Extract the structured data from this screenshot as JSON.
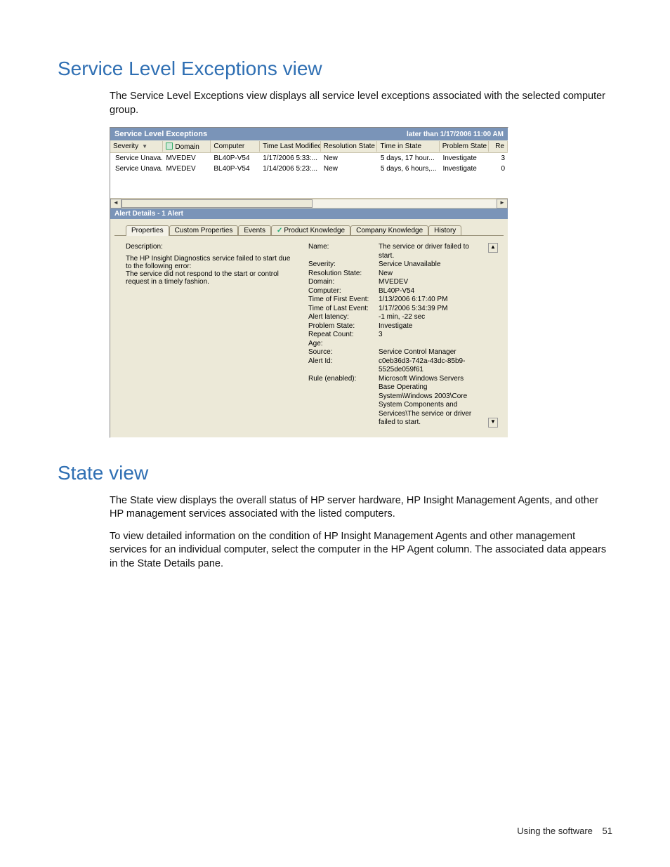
{
  "sections": {
    "sle": {
      "heading": "Service Level Exceptions view",
      "para": "The Service Level Exceptions view displays all service level exceptions associated with the selected computer group."
    },
    "state": {
      "heading": "State view",
      "para1": "The State view displays the overall status of HP server hardware, HP Insight Management Agents, and other HP management services associated with the listed computers.",
      "para2": "To view detailed information on the condition of HP Insight Management Agents and other management services for an individual computer, select the computer in the HP Agent column. The associated data appears in the State Details pane."
    }
  },
  "screenshot": {
    "title": "Service Level Exceptions",
    "stamp": "later than 1/17/2006 11:00 AM",
    "columns": {
      "severity": "Severity",
      "domain": "Domain",
      "computer": "Computer",
      "time_last_modified": "Time Last Modified",
      "resolution_state": "Resolution State",
      "time_in_state": "Time in State",
      "problem_state": "Problem State",
      "re": "Re"
    },
    "rows": [
      {
        "severity": "Service Unava...",
        "domain": "MVEDEV",
        "computer": "BL40P-V54",
        "time": "1/17/2006 5:33:...",
        "res": "New",
        "tis": "5 days, 17 hour...",
        "ps": "Investigate",
        "re": "3"
      },
      {
        "severity": "Service Unava...",
        "domain": "MVEDEV",
        "computer": "BL40P-V54",
        "time": "1/14/2006 5:23:...",
        "res": "New",
        "tis": "5 days, 6 hours,...",
        "ps": "Investigate",
        "re": "0"
      }
    ],
    "details_header": "Alert Details - 1 Alert",
    "tabs": {
      "properties": "Properties",
      "custom_properties": "Custom Properties",
      "events": "Events",
      "product_knowledge": "Product Knowledge",
      "company_knowledge": "Company Knowledge",
      "history": "History"
    },
    "description": {
      "label": "Description:",
      "line1": "The HP Insight Diagnostics service failed to start due to the following error:",
      "line2": "The service did not respond to the start or control request in a timely fashion."
    },
    "kv": {
      "name_k": "Name:",
      "name_v": "The service or driver failed to start.",
      "severity_k": "Severity:",
      "severity_v": "Service Unavailable",
      "res_k": "Resolution State:",
      "res_v": "New",
      "domain_k": "Domain:",
      "domain_v": "MVEDEV",
      "computer_k": "Computer:",
      "computer_v": "BL40P-V54",
      "tfe_k": "Time of First Event:",
      "tfe_v": "1/13/2006 6:17:40 PM",
      "tle_k": "Time of Last Event:",
      "tle_v": "1/17/2006 5:34:39 PM",
      "lat_k": "Alert latency:",
      "lat_v": "-1 min, -22 sec",
      "ps_k": "Problem State:",
      "ps_v": "Investigate",
      "rc_k": "Repeat Count:",
      "rc_v": "3",
      "age_k": "Age:",
      "age_v": "",
      "src_k": "Source:",
      "src_v": "Service Control Manager",
      "aid_k": "Alert Id:",
      "aid_v": "c0eb36d3-742a-43dc-85b9-5525de059f61",
      "rule_k": "Rule (enabled):",
      "rule_v": "Microsoft Windows Servers Base Operating System\\Windows 2003\\Core System Components and Services\\The service or driver failed to start."
    }
  },
  "footer": {
    "text": "Using the software",
    "page": "51"
  }
}
